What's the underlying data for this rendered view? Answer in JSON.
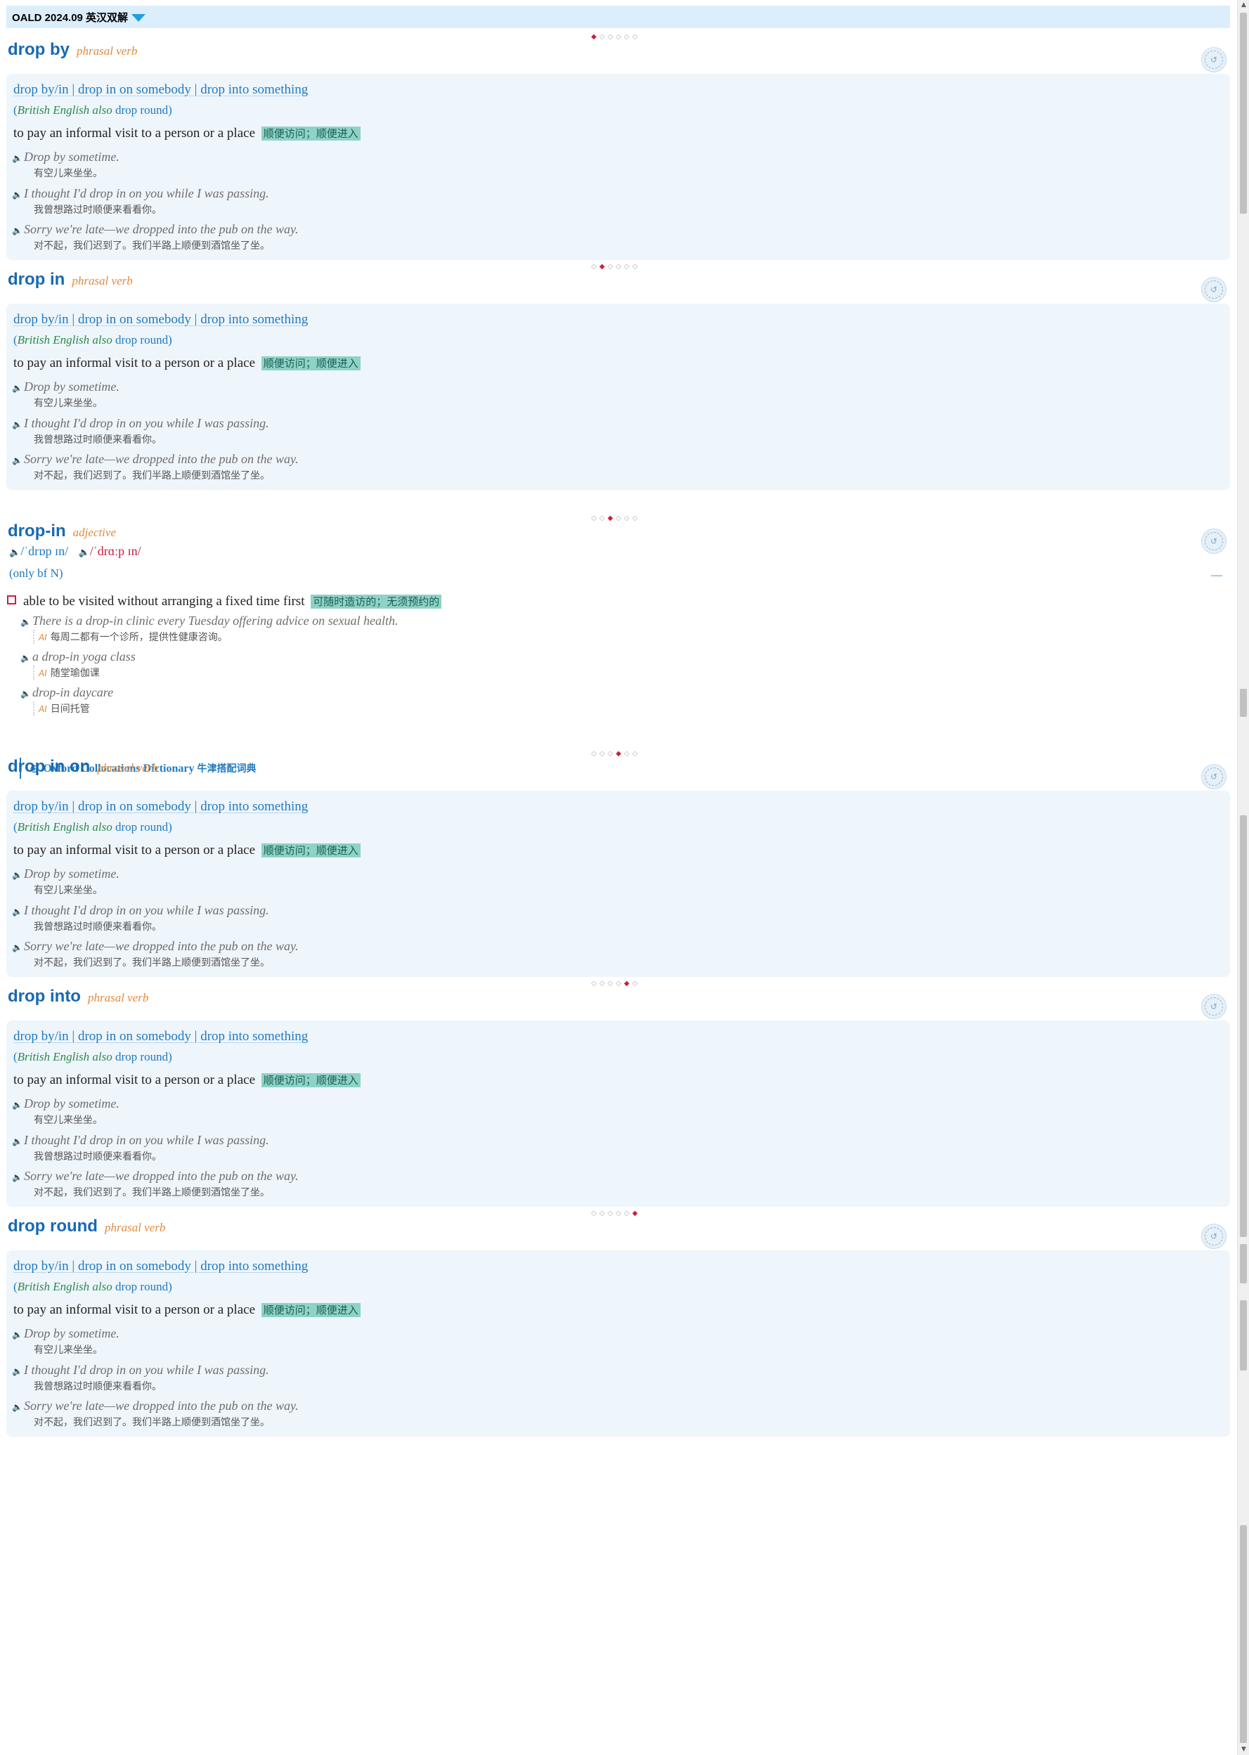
{
  "dictionary": {
    "title": "OALD 2024.09 英汉双解"
  },
  "common_phrasal": {
    "head": "drop by/in | drop in on somebody | drop into something",
    "variant_open": "(",
    "variant_label": "British English also",
    "variant_word": "drop round",
    "variant_close": ")",
    "definition": "to pay an informal visit to a person or a place",
    "definition_zh": "顺便访问；顺便进入",
    "examples": [
      {
        "en": "Drop by sometime.",
        "zh": "有空儿来坐坐。"
      },
      {
        "en": "I thought I'd drop in on you while I was passing.",
        "zh": "我曾想路过时顺便来看看你。"
      },
      {
        "en": "Sorry we're late—we dropped into the pub on the way.",
        "zh": "对不起，我们迟到了。我们半路上顺便到酒馆坐了坐。"
      }
    ]
  },
  "entries": {
    "e1": {
      "headword": "drop by",
      "pos": "phrasal verb"
    },
    "e2": {
      "headword": "drop in",
      "pos": "phrasal verb"
    },
    "e3": {
      "headword": "drop-in",
      "pos": "adjective",
      "pron_br": "/ˈdrɒp ɪn/",
      "pron_am": "/ˈdrɑːp ɪn/",
      "grammar": "(only bf N)",
      "collapse_mark": "—",
      "definition": "able to be visited without arranging a fixed time first",
      "definition_zh": "可随时造访的；无须预约的",
      "ai_label": "AI",
      "examples": [
        {
          "en": "There is a drop-in clinic every Tuesday offering advice on sexual health.",
          "zh": "每周二都有一个诊所，提供性健康咨询。"
        },
        {
          "en": "a drop-in yoga class",
          "zh": "随堂瑜伽课"
        },
        {
          "en": "drop-in daycare",
          "zh": "日间托管"
        }
      ],
      "collocations": {
        "plus": "⊕",
        "label": "Oxford Collocations Dictionary",
        "label_zh": "牛津搭配词典"
      }
    },
    "e4": {
      "headword": "drop in on",
      "pos": "phrasal verb"
    },
    "e5": {
      "headword": "drop into",
      "pos": "phrasal verb"
    },
    "e6": {
      "headword": "drop round",
      "pos": "phrasal verb"
    }
  },
  "nav": {
    "active_color": "#c8203e",
    "inactive_color": "#aaaaaa",
    "count": 6
  },
  "icons": {
    "speaker": "speaker-icon",
    "collapse_circle": "collapse-circle-icon",
    "dropdown": "dropdown-arrow-icon"
  }
}
